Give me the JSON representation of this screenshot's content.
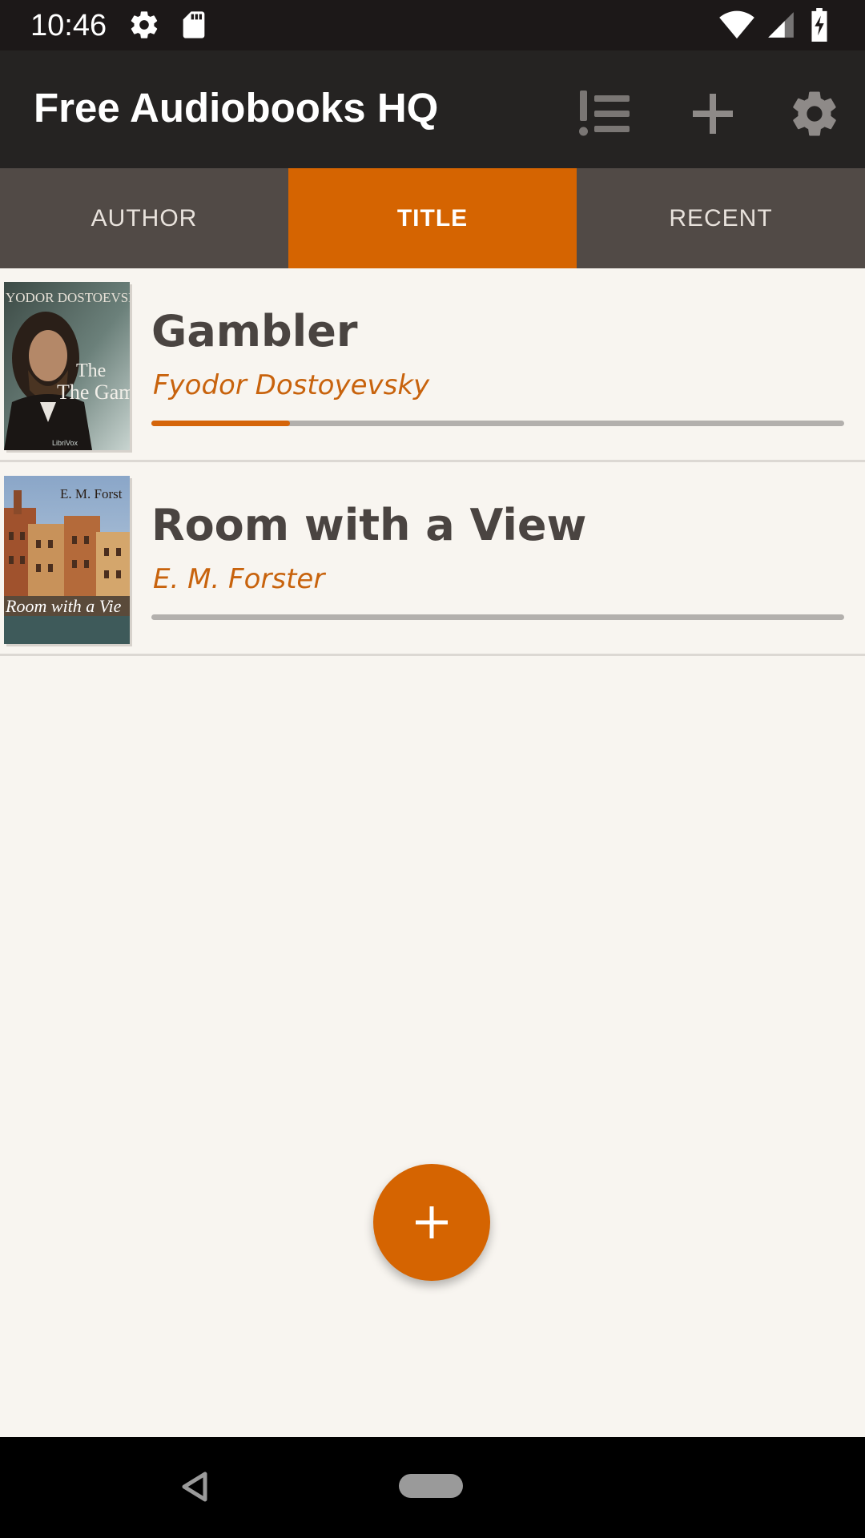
{
  "status_bar": {
    "time": "10:46",
    "icons": [
      "settings-icon",
      "sd-card-icon",
      "wifi-icon",
      "signal-icon",
      "battery-charging-icon"
    ]
  },
  "app_bar": {
    "title": "Free Audiobooks HQ",
    "actions": [
      "priority-list-icon",
      "add-icon",
      "settings-icon"
    ]
  },
  "tabs": [
    {
      "label": "AUTHOR",
      "active": false
    },
    {
      "label": "TITLE",
      "active": true
    },
    {
      "label": "RECENT",
      "active": false
    }
  ],
  "books": [
    {
      "title": "Gambler",
      "author": "Fyodor Dostoyevsky",
      "progress": 0.2,
      "cover": {
        "top_text": "YODOR DOSTOEVSK",
        "title_text": "The Gamble",
        "publisher": "LibriVox"
      }
    },
    {
      "title": "Room with a View",
      "author": "E. M. Forster",
      "progress": 0,
      "cover": {
        "top_text": "E. M. Forst",
        "title_text": "Room with a Vie"
      }
    }
  ],
  "fab": {
    "icon": "add-icon"
  },
  "nav_bar": {
    "icons": [
      "back-icon",
      "home-pill"
    ]
  },
  "colors": {
    "accent": "#d56401",
    "app_bar": "#252322",
    "tab_bar": "#514a46",
    "background": "#f8f5f0",
    "title_text": "#4a4441",
    "author_text": "#c8630d"
  }
}
